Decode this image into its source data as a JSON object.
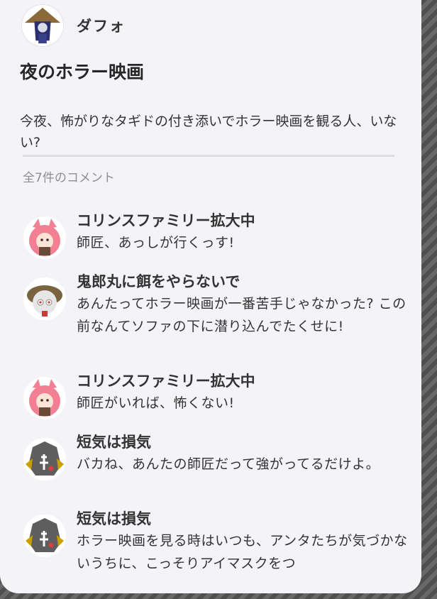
{
  "post": {
    "author": "ダフォ",
    "author_avatar_icon": "character-avatar-icon",
    "title": "夜のホラー映画",
    "body": "今夜、怖がりなタギドの付き添いでホラー映画を観る人、いない?"
  },
  "comments_header": "全7件のコメント",
  "comments": [
    {
      "name": "コリンスファミリー拡大中",
      "text": "師匠、あっしが行くっす!",
      "avatar_icon": "pink-character-avatar-icon"
    },
    {
      "name": "鬼郎丸に餌をやらないで",
      "text": "あんたってホラー映画が一番苦手じゃなかった? この前なんてソファの下に潜り込んでたくせに!",
      "avatar_icon": "white-character-avatar-icon"
    },
    {
      "name": "コリンスファミリー拡大中",
      "text": "師匠がいれば、怖くない!",
      "avatar_icon": "pink-character-avatar-icon"
    },
    {
      "name": "短気は損気",
      "text": "バカね、あんたの師匠だって強がってるだけよ。",
      "avatar_icon": "gray-character-avatar-icon"
    },
    {
      "name": "短気は損気",
      "text": "ホラー映画を見る時はいつも、アンタたちが気づかないうちに、こっそりアイマスクをつ",
      "avatar_icon": "gray-character-avatar-icon"
    }
  ],
  "colors": {
    "card_background": "#f4f3f7",
    "text_primary": "#333333",
    "text_secondary": "#8e8e93",
    "divider": "#dcdce2"
  }
}
